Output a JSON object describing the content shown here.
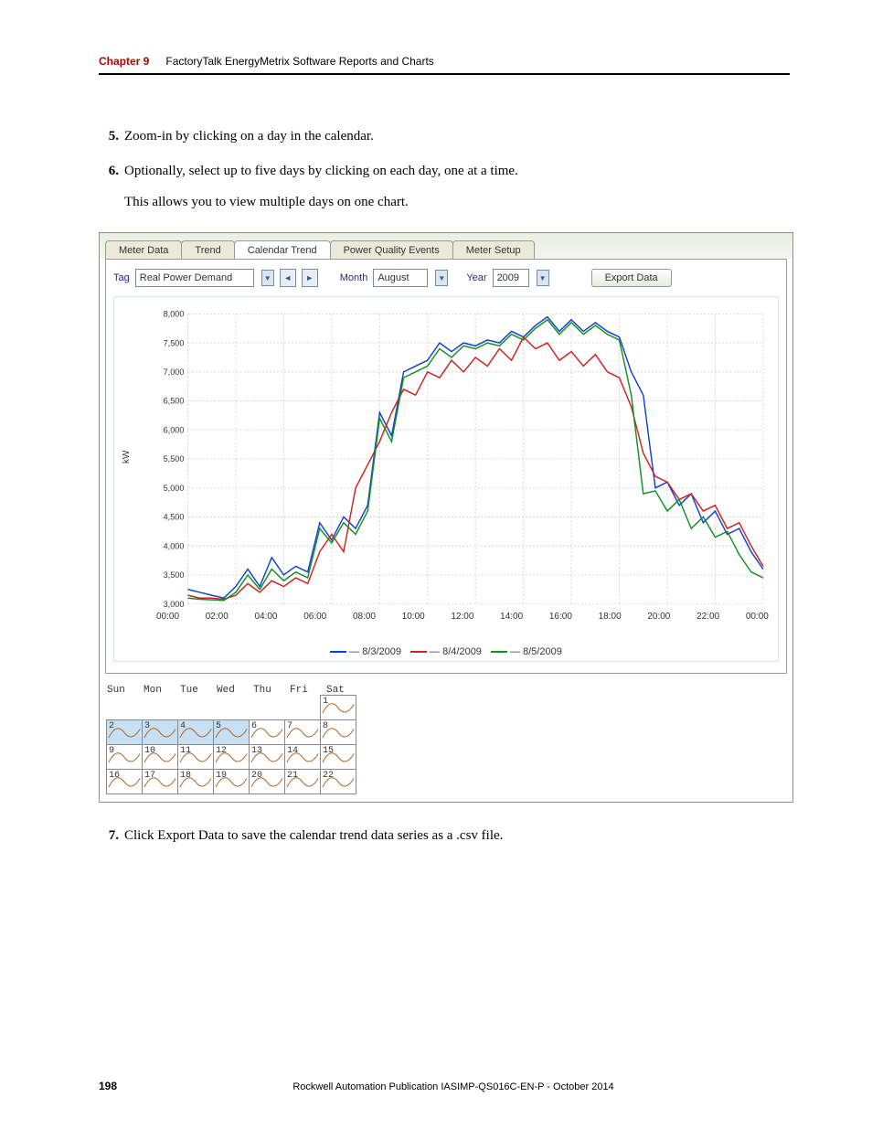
{
  "header": {
    "chapter": "Chapter 9",
    "title": "FactoryTalk EnergyMetrix Software Reports and Charts"
  },
  "steps": {
    "s5": {
      "n": "5.",
      "t": "Zoom-in by clicking on a day in the calendar."
    },
    "s6": {
      "n": "6.",
      "t": "Optionally, select up to five days by clicking on each day, one at a time."
    },
    "s6b": "This allows you to view multiple days on one chart.",
    "s7": {
      "n": "7.",
      "t": "Click Export Data to save the calendar trend data series as a .csv file."
    }
  },
  "ui": {
    "tabs": [
      "Meter Data",
      "Trend",
      "Calendar Trend",
      "Power Quality Events",
      "Meter Setup"
    ],
    "tag_label": "Tag",
    "tag_value": "Real Power Demand",
    "month_label": "Month",
    "month_value": "August",
    "year_label": "Year",
    "year_value": "2009",
    "export": "Export Data",
    "y_title": "kW",
    "legend": [
      "8/3/2009",
      "8/4/2009",
      "8/5/2009"
    ],
    "cal_days": [
      "Sun",
      "Mon",
      "Tue",
      "Wed",
      "Thu",
      "Fri",
      "Sat"
    ]
  },
  "footer": {
    "page": "198",
    "pub": "Rockwell Automation Publication IASIMP-QS016C-EN-P - October 2014"
  },
  "chart_data": {
    "type": "line",
    "title": "",
    "xlabel": "",
    "ylabel": "kW",
    "ylim": [
      3000,
      8000
    ],
    "y_ticks": [
      3000,
      3500,
      4000,
      4500,
      5000,
      5500,
      6000,
      6500,
      7000,
      7500,
      8000
    ],
    "x_ticks": [
      "00:00",
      "02:00",
      "04:00",
      "06:00",
      "08:00",
      "10:00",
      "12:00",
      "14:00",
      "16:00",
      "18:00",
      "20:00",
      "22:00",
      "00:00"
    ],
    "series": [
      {
        "name": "8/3/2009",
        "color": "#1040d0",
        "values": [
          3250,
          3200,
          3150,
          3100,
          3300,
          3600,
          3300,
          3800,
          3500,
          3650,
          3550,
          4400,
          4100,
          4500,
          4300,
          4700,
          6300,
          5900,
          7000,
          7100,
          7200,
          7500,
          7350,
          7500,
          7450,
          7550,
          7500,
          7700,
          7600,
          7800,
          7950,
          7700,
          7900,
          7700,
          7850,
          7700,
          7600,
          7000,
          6600,
          5000,
          5100,
          4700,
          4900,
          4400,
          4600,
          4200,
          4300,
          3900,
          3600
        ]
      },
      {
        "name": "8/4/2009",
        "color": "#d02020",
        "values": [
          3150,
          3100,
          3100,
          3080,
          3150,
          3350,
          3200,
          3400,
          3300,
          3450,
          3350,
          3900,
          4200,
          3900,
          5000,
          5400,
          5800,
          6300,
          6700,
          6600,
          7000,
          6900,
          7200,
          7000,
          7250,
          7100,
          7400,
          7200,
          7600,
          7400,
          7500,
          7200,
          7350,
          7100,
          7300,
          7000,
          6900,
          6400,
          5600,
          5200,
          5100,
          4800,
          4900,
          4600,
          4700,
          4300,
          4400,
          4000,
          3650
        ]
      },
      {
        "name": "8/5/2009",
        "color": "#109020",
        "values": [
          3100,
          3080,
          3070,
          3060,
          3200,
          3500,
          3250,
          3600,
          3400,
          3550,
          3450,
          4300,
          4050,
          4400,
          4200,
          4600,
          6200,
          5800,
          6900,
          7000,
          7100,
          7400,
          7250,
          7450,
          7400,
          7500,
          7450,
          7650,
          7550,
          7750,
          7900,
          7650,
          7850,
          7650,
          7800,
          7650,
          7550,
          6600,
          4900,
          4950,
          4600,
          4800,
          4300,
          4500,
          4150,
          4250,
          3850,
          3550,
          3450
        ]
      }
    ]
  },
  "calendar": {
    "rows": [
      [
        null,
        null,
        null,
        null,
        null,
        null,
        {
          "n": "1"
        }
      ],
      [
        {
          "n": "2",
          "sel": true
        },
        {
          "n": "3",
          "sel": true
        },
        {
          "n": "4",
          "sel": true
        },
        {
          "n": "5",
          "sel": true
        },
        {
          "n": "6"
        },
        {
          "n": "7"
        },
        {
          "n": "8"
        }
      ],
      [
        {
          "n": "9"
        },
        {
          "n": "10"
        },
        {
          "n": "11"
        },
        {
          "n": "12"
        },
        {
          "n": "13"
        },
        {
          "n": "14"
        },
        {
          "n": "15"
        }
      ],
      [
        {
          "n": "16"
        },
        {
          "n": "17"
        },
        {
          "n": "18"
        },
        {
          "n": "19"
        },
        {
          "n": "20"
        },
        {
          "n": "21"
        },
        {
          "n": "22"
        }
      ]
    ]
  }
}
